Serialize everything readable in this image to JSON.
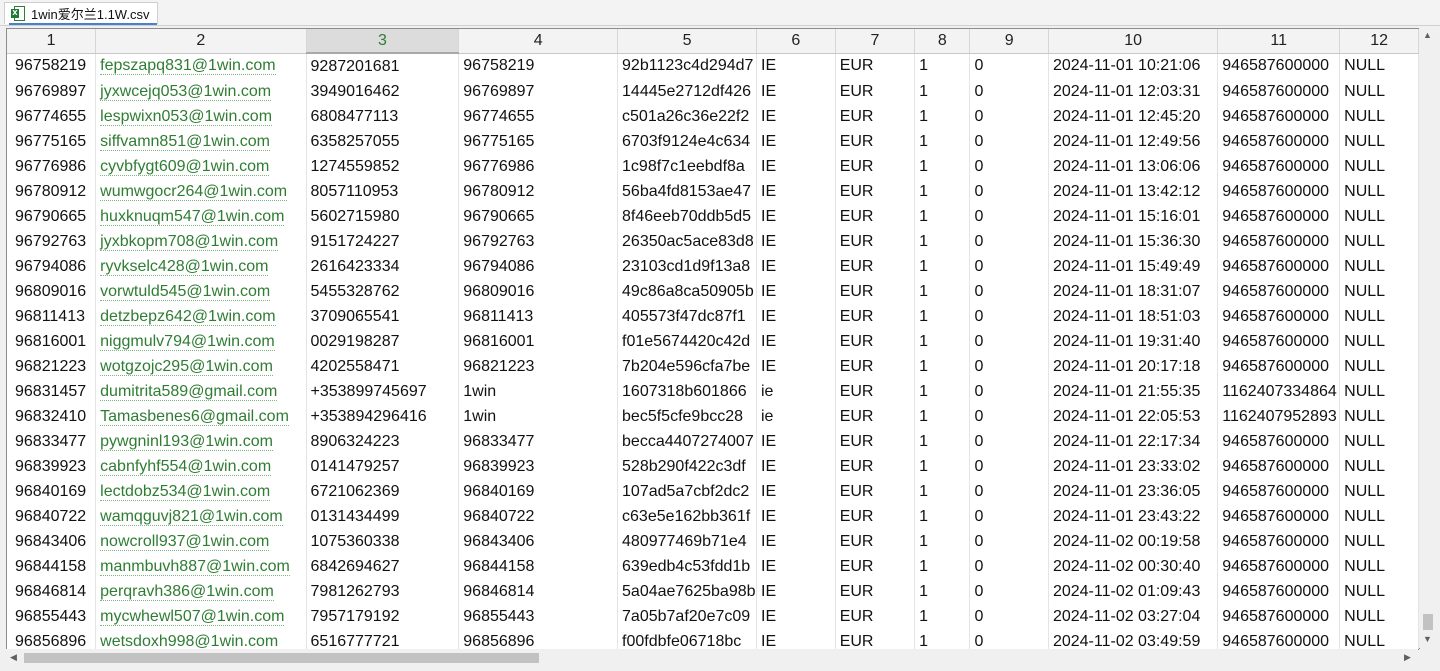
{
  "tab": {
    "title": "1win爱尔兰1.1W.csv",
    "icon": "excel-file-icon"
  },
  "columns": [
    "1",
    "2",
    "3",
    "4",
    "5",
    "6",
    "7",
    "8",
    "9",
    "10",
    "11",
    "12"
  ],
  "selected_column": 2,
  "rows": [
    [
      "96758219",
      "fepszapq831@1win.com",
      "9287201681",
      "96758219",
      "92b1123c4d294d7",
      "IE",
      "EUR",
      "1",
      "0",
      "2024-11-01 10:21:06",
      "946587600000",
      "NULL"
    ],
    [
      "96769897",
      "jyxwcejq053@1win.com",
      "3949016462",
      "96769897",
      "14445e2712df426",
      "IE",
      "EUR",
      "1",
      "0",
      "2024-11-01 12:03:31",
      "946587600000",
      "NULL"
    ],
    [
      "96774655",
      "lespwixn053@1win.com",
      "6808477113",
      "96774655",
      "c501a26c36e22f2",
      "IE",
      "EUR",
      "1",
      "0",
      "2024-11-01 12:45:20",
      "946587600000",
      "NULL"
    ],
    [
      "96775165",
      "siffvamn851@1win.com",
      "6358257055",
      "96775165",
      "6703f9124e4c634",
      "IE",
      "EUR",
      "1",
      "0",
      "2024-11-01 12:49:56",
      "946587600000",
      "NULL"
    ],
    [
      "96776986",
      "cyvbfygt609@1win.com",
      "1274559852",
      "96776986",
      "1c98f7c1eebdf8a",
      "IE",
      "EUR",
      "1",
      "0",
      "2024-11-01 13:06:06",
      "946587600000",
      "NULL"
    ],
    [
      "96780912",
      "wumwgocr264@1win.com",
      "8057110953",
      "96780912",
      "56ba4fd8153ae47",
      "IE",
      "EUR",
      "1",
      "0",
      "2024-11-01 13:42:12",
      "946587600000",
      "NULL"
    ],
    [
      "96790665",
      "huxknuqm547@1win.com",
      "5602715980",
      "96790665",
      "8f46eeb70ddb5d5",
      "IE",
      "EUR",
      "1",
      "0",
      "2024-11-01 15:16:01",
      "946587600000",
      "NULL"
    ],
    [
      "96792763",
      "jyxbkopm708@1win.com",
      "9151724227",
      "96792763",
      "26350ac5ace83d8",
      "IE",
      "EUR",
      "1",
      "0",
      "2024-11-01 15:36:30",
      "946587600000",
      "NULL"
    ],
    [
      "96794086",
      "ryvkselc428@1win.com",
      "2616423334",
      "96794086",
      "23103cd1d9f13a8",
      "IE",
      "EUR",
      "1",
      "0",
      "2024-11-01 15:49:49",
      "946587600000",
      "NULL"
    ],
    [
      "96809016",
      "vorwtuld545@1win.com",
      "5455328762",
      "96809016",
      "49c86a8ca50905b",
      "IE",
      "EUR",
      "1",
      "0",
      "2024-11-01 18:31:07",
      "946587600000",
      "NULL"
    ],
    [
      "96811413",
      "detzbepz642@1win.com",
      "3709065541",
      "96811413",
      "405573f47dc87f1",
      "IE",
      "EUR",
      "1",
      "0",
      "2024-11-01 18:51:03",
      "946587600000",
      "NULL"
    ],
    [
      "96816001",
      "niggmulv794@1win.com",
      "0029198287",
      "96816001",
      "f01e5674420c42d",
      "IE",
      "EUR",
      "1",
      "0",
      "2024-11-01 19:31:40",
      "946587600000",
      "NULL"
    ],
    [
      "96821223",
      "wotgzojc295@1win.com",
      "4202558471",
      "96821223",
      "7b204e596cfa7be",
      "IE",
      "EUR",
      "1",
      "0",
      "2024-11-01 20:17:18",
      "946587600000",
      "NULL"
    ],
    [
      "96831457",
      "dumitrita589@gmail.com",
      "+353899745697",
      "1win",
      "1607318b601866",
      "ie",
      "EUR",
      "1",
      "0",
      "2024-11-01 21:55:35",
      "1162407334864",
      "NULL"
    ],
    [
      "96832410",
      "Tamasbenes6@gmail.com",
      "+353894296416",
      "1win",
      "bec5f5cfe9bcc28",
      "ie",
      "EUR",
      "1",
      "0",
      "2024-11-01 22:05:53",
      "1162407952893",
      "NULL"
    ],
    [
      "96833477",
      "pywgninl193@1win.com",
      "8906324223",
      "96833477",
      "becca4407274007",
      "IE",
      "EUR",
      "1",
      "0",
      "2024-11-01 22:17:34",
      "946587600000",
      "NULL"
    ],
    [
      "96839923",
      "cabnfyhf554@1win.com",
      "0141479257",
      "96839923",
      "528b290f422c3df",
      "IE",
      "EUR",
      "1",
      "0",
      "2024-11-01 23:33:02",
      "946587600000",
      "NULL"
    ],
    [
      "96840169",
      "lectdobz534@1win.com",
      "6721062369",
      "96840169",
      "107ad5a7cbf2dc2",
      "IE",
      "EUR",
      "1",
      "0",
      "2024-11-01 23:36:05",
      "946587600000",
      "NULL"
    ],
    [
      "96840722",
      "wamqguvj821@1win.com",
      "0131434499",
      "96840722",
      "c63e5e162bb361f",
      "IE",
      "EUR",
      "1",
      "0",
      "2024-11-01 23:43:22",
      "946587600000",
      "NULL"
    ],
    [
      "96843406",
      "nowcroll937@1win.com",
      "1075360338",
      "96843406",
      "480977469b71e4",
      "IE",
      "EUR",
      "1",
      "0",
      "2024-11-02 00:19:58",
      "946587600000",
      "NULL"
    ],
    [
      "96844158",
      "manmbuvh887@1win.com",
      "6842694627",
      "96844158",
      "639edb4c53fdd1b",
      "IE",
      "EUR",
      "1",
      "0",
      "2024-11-02 00:30:40",
      "946587600000",
      "NULL"
    ],
    [
      "96846814",
      "perqravh386@1win.com",
      "7981262793",
      "96846814",
      "5a04ae7625ba98b",
      "IE",
      "EUR",
      "1",
      "0",
      "2024-11-02 01:09:43",
      "946587600000",
      "NULL"
    ],
    [
      "96855443",
      "mycwhewl507@1win.com",
      "7957179192",
      "96855443",
      "7a05b7af20e7c09",
      "IE",
      "EUR",
      "1",
      "0",
      "2024-11-02 03:27:04",
      "946587600000",
      "NULL"
    ],
    [
      "96856896",
      "wetsdoxh998@1win.com",
      "6516777721",
      "96856896",
      "f00fdbfe06718bc",
      "IE",
      "EUR",
      "1",
      "0",
      "2024-11-02 03:49:59",
      "946587600000",
      "NULL"
    ]
  ]
}
